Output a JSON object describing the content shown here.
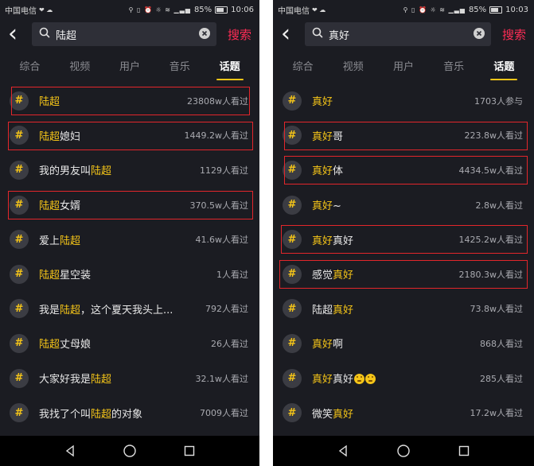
{
  "screens": [
    {
      "status": {
        "carrier": "中国电信",
        "battery": "85%",
        "time": "10:06"
      },
      "search": {
        "query": "陆超",
        "button": "搜索"
      },
      "tabs": [
        "综合",
        "视频",
        "用户",
        "音乐",
        "话题"
      ],
      "active_tab": 4,
      "items": [
        {
          "pre": "",
          "hl": "陆超",
          "post": "",
          "count": "23808w人看过",
          "boxed": true
        },
        {
          "pre": "",
          "hl": "陆超",
          "post": "媳妇",
          "count": "1449.2w人看过",
          "boxed": true
        },
        {
          "pre": "我的男友叫",
          "hl": "陆超",
          "post": "",
          "count": "1129人看过",
          "boxed": false
        },
        {
          "pre": "",
          "hl": "陆超",
          "post": "女婿",
          "count": "370.5w人看过",
          "boxed": true
        },
        {
          "pre": "爱上",
          "hl": "陆超",
          "post": "",
          "count": "41.6w人看过",
          "boxed": false
        },
        {
          "pre": "",
          "hl": "陆超",
          "post": "星空装",
          "count": "1人看过",
          "boxed": false
        },
        {
          "pre": "我是",
          "hl": "陆超",
          "post": "，这个夏天我头上...",
          "count": "792人看过",
          "boxed": false
        },
        {
          "pre": "",
          "hl": "陆超",
          "post": "丈母娘",
          "count": "26人看过",
          "boxed": false
        },
        {
          "pre": "大家好我是",
          "hl": "陆超",
          "post": "",
          "count": "32.1w人看过",
          "boxed": false
        },
        {
          "pre": "我找了个叫",
          "hl": "陆超",
          "post": "的对象",
          "count": "7009人看过",
          "boxed": false
        }
      ]
    },
    {
      "status": {
        "carrier": "中国电信",
        "battery": "85%",
        "time": "10:03"
      },
      "search": {
        "query": "真好",
        "button": "搜索"
      },
      "tabs": [
        "综合",
        "视频",
        "用户",
        "音乐",
        "话题"
      ],
      "active_tab": 4,
      "items": [
        {
          "pre": "",
          "hl": "真好",
          "post": "",
          "count": "1703人参与",
          "boxed": false
        },
        {
          "pre": "",
          "hl": "真好",
          "post": "哥",
          "count": "223.8w人看过",
          "boxed": true
        },
        {
          "pre": "",
          "hl": "真好",
          "post": "体",
          "count": "4434.5w人看过",
          "boxed": true
        },
        {
          "pre": "",
          "hl": "真好",
          "post": "~",
          "count": "2.8w人看过",
          "boxed": false
        },
        {
          "pre": "",
          "hl": "真好",
          "post": "真好",
          "count": "1425.2w人看过",
          "boxed": true
        },
        {
          "pre": "感觉",
          "hl": "真好",
          "post": "",
          "count": "2180.3w人看过",
          "boxed": true
        },
        {
          "pre": "陆超",
          "hl": "真好",
          "post": "",
          "count": "73.8w人看过",
          "boxed": false
        },
        {
          "pre": "",
          "hl": "真好",
          "post": "啊",
          "count": "868人看过",
          "boxed": false
        },
        {
          "pre": "",
          "hl": "真好",
          "post": "真好",
          "count": "285人看过",
          "boxed": false,
          "emoji": 2
        },
        {
          "pre": "微笑",
          "hl": "真好",
          "post": "",
          "count": "17.2w人看过",
          "boxed": false
        }
      ]
    }
  ]
}
